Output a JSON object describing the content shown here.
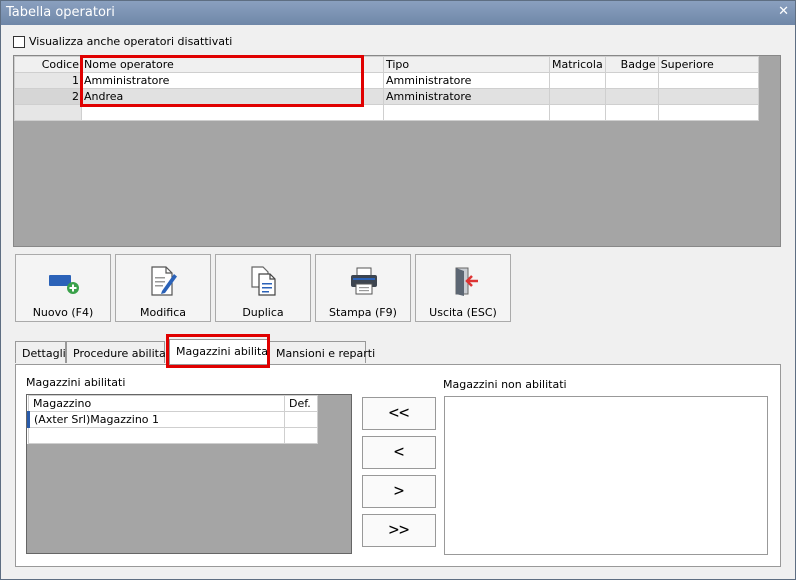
{
  "window": {
    "title": "Tabella operatori",
    "close_glyph": "✕"
  },
  "filter": {
    "show_disabled_label": "Visualizza anche operatori disattivati",
    "checked": false
  },
  "grid": {
    "columns": [
      "Codice",
      "Nome operatore",
      "Tipo",
      "Matricola",
      "Badge",
      "Superiore"
    ],
    "rows": [
      {
        "codice": "1",
        "nome": "Amministratore",
        "tipo": "Amministratore",
        "matricola": "",
        "badge": "",
        "superiore": ""
      },
      {
        "codice": "2",
        "nome": "Andrea",
        "tipo": "Amministratore",
        "matricola": "",
        "badge": "",
        "superiore": ""
      }
    ]
  },
  "toolbar": {
    "nuovo": "Nuovo (F4)",
    "modifica": "Modifica",
    "duplica": "Duplica",
    "stampa": "Stampa (F9)",
    "uscita": "Uscita (ESC)"
  },
  "tabs": [
    "Dettagli",
    "Procedure abilitate",
    "Magazzini abilitati",
    "Mansioni e reparti"
  ],
  "active_tab": 2,
  "magazzini": {
    "enabled_label": "Magazzini abilitati",
    "disabled_label": "Magazzini non abilitati",
    "columns": [
      "Magazzino",
      "Def."
    ],
    "rows": [
      {
        "magazzino": "(Axter Srl)Magazzino 1",
        "def": ""
      }
    ],
    "buttons": {
      "add_all": "<<",
      "add": "<",
      "remove": ">",
      "remove_all": ">>"
    }
  },
  "colors": {
    "titlebar": "#7a90b0",
    "highlight": "#e00000",
    "grid_empty": "#a5a5a5"
  },
  "icons": {
    "nuovo": "add-operator-icon",
    "modifica": "edit-document-icon",
    "duplica": "duplicate-icon",
    "stampa": "printer-icon",
    "uscita": "exit-door-icon"
  }
}
